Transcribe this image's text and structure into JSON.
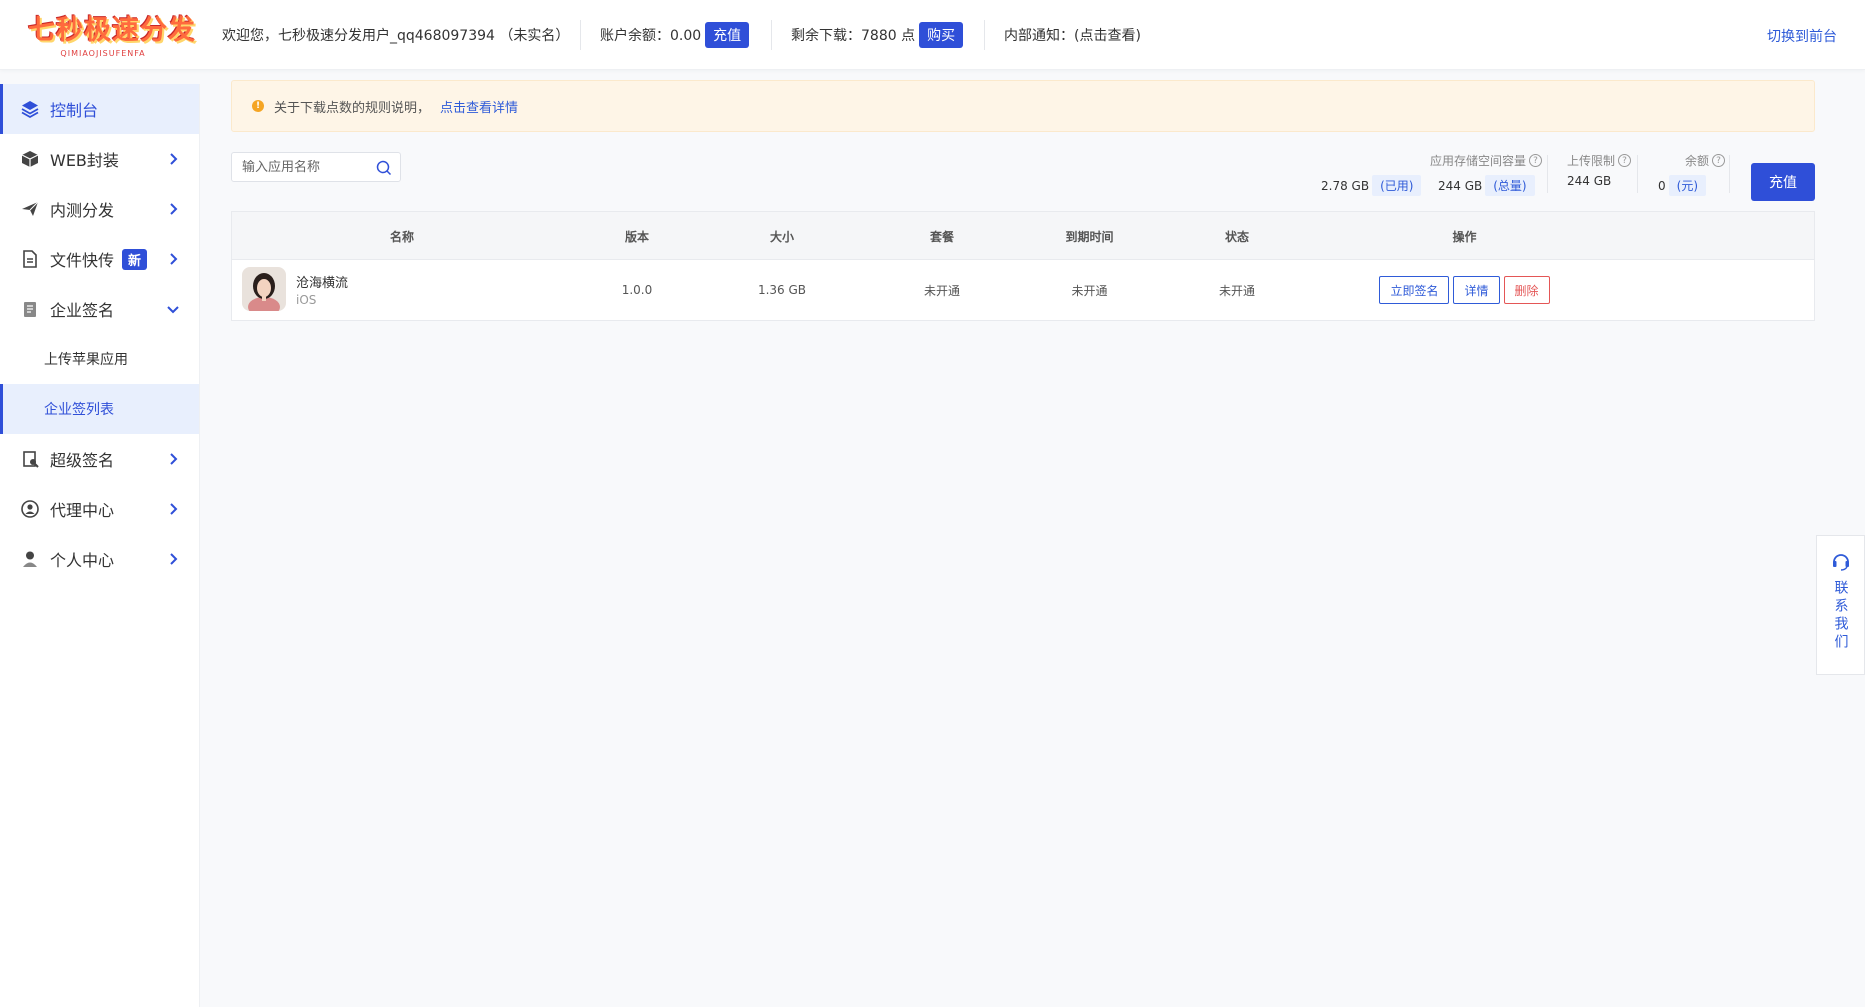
{
  "header": {
    "logo_text": "七秒极速分发",
    "logo_sub": "QIMIAOJISUFENFA",
    "welcome": "欢迎您，七秒极速分发用户_qq468097394 （未实名）",
    "balance_label": "账户余额：0.00",
    "balance_button": "充值",
    "download_label": "剩余下载：7880 点",
    "download_button": "购买",
    "notice_label": "内部通知：(点击查看)",
    "switch_link": "切换到前台"
  },
  "sidebar": {
    "items": [
      {
        "label": "控制台",
        "icon": "layers-icon"
      },
      {
        "label": "WEB封装",
        "icon": "box-icon"
      },
      {
        "label": "内测分发",
        "icon": "paper-plane-icon"
      },
      {
        "label": "文件快传",
        "icon": "file-icon",
        "badge": "新"
      },
      {
        "label": "企业签名",
        "icon": "document-icon"
      },
      {
        "label": "超级签名",
        "icon": "signature-icon"
      },
      {
        "label": "代理中心",
        "icon": "agent-icon"
      },
      {
        "label": "个人中心",
        "icon": "user-icon"
      }
    ],
    "sub_items": [
      {
        "label": "上传苹果应用"
      },
      {
        "label": "企业签列表"
      }
    ]
  },
  "notice": {
    "text": "关于下载点数的规则说明，",
    "link": "点击查看详情"
  },
  "search": {
    "placeholder": "输入应用名称"
  },
  "stats": {
    "storage_label": "应用存储空间容量",
    "storage_used": "2.78 GB",
    "storage_used_tag": "(已用)",
    "storage_total": "244 GB",
    "storage_total_tag": "(总量)",
    "upload_label": "上传限制",
    "upload_value": "244 GB",
    "balance_label": "余额",
    "balance_value": "0",
    "balance_tag": "(元)",
    "recharge_button": "充值"
  },
  "table": {
    "headers": [
      "名称",
      "版本",
      "大小",
      "套餐",
      "到期时间",
      "状态",
      "操作"
    ],
    "rows": [
      {
        "name": "沧海横流",
        "platform": "iOS",
        "version": "1.0.0",
        "size": "1.36 GB",
        "plan": "未开通",
        "expire": "未开通",
        "status": "未开通",
        "actions": [
          "立即签名",
          "详情",
          "删除"
        ]
      }
    ]
  },
  "contact": {
    "label": "联系我们"
  },
  "colors": {
    "primary": "#2f4fd8",
    "danger": "#e45656",
    "notice_bg": "#fef5e7"
  }
}
